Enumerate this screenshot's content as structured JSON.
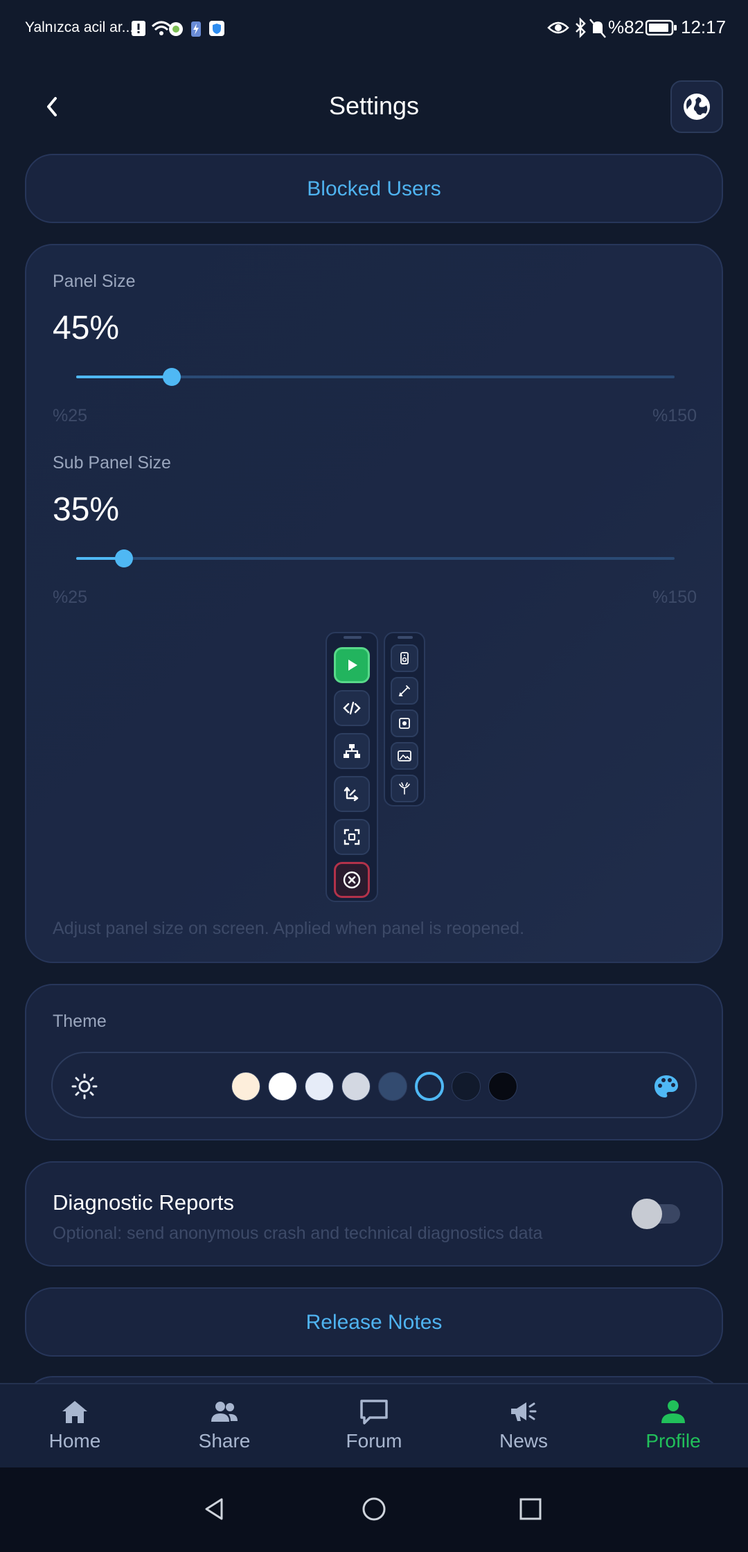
{
  "status_bar": {
    "left_text": "Yalnızca acil ar...",
    "battery": "%82",
    "time": "12:17"
  },
  "header": {
    "title": "Settings",
    "back_icon": "chevron-left-icon",
    "globe_icon": "globe-icon"
  },
  "blocked_users": {
    "label": "Blocked Users"
  },
  "panel_size": {
    "label": "Panel Size",
    "value_text": "45%",
    "value_percent": 45,
    "min_label": "%25",
    "max_label": "%150",
    "min": 25,
    "max": 150
  },
  "sub_panel_size": {
    "label": "Sub Panel Size",
    "value_text": "35%",
    "value_percent": 35,
    "min_label": "%25",
    "max_label": "%150",
    "min": 25,
    "max": 150
  },
  "panel_hint": "Adjust panel size on screen. Applied when panel is reopened.",
  "panel_preview": {
    "main_icons": [
      "play-icon",
      "code-icon",
      "sitemap-icon",
      "arrows-icon",
      "capture-icon",
      "close-icon"
    ],
    "sub_icons": [
      "speaker-icon",
      "brush-icon",
      "record-icon",
      "image-icon",
      "lamp-icon"
    ]
  },
  "theme": {
    "label": "Theme",
    "left_icon": "sun-icon",
    "right_icon": "palette-icon",
    "swatches": [
      "#fdeedb",
      "#ffffff",
      "#e6ecf8",
      "#d3d8e2",
      "#334b70",
      "#18243e",
      "#111a2c",
      "#070a12"
    ],
    "selected_index": 5,
    "accent": "#4fb8f4"
  },
  "diagnostics": {
    "title": "Diagnostic Reports",
    "subtitle": "Optional: send anonymous crash and technical diagnostics data",
    "enabled": false
  },
  "release_notes": {
    "label": "Release Notes"
  },
  "nav": {
    "items": [
      {
        "label": "Home",
        "icon": "home-icon",
        "active": false
      },
      {
        "label": "Share",
        "icon": "users-icon",
        "active": false
      },
      {
        "label": "Forum",
        "icon": "chat-icon",
        "active": false
      },
      {
        "label": "News",
        "icon": "megaphone-icon",
        "active": false
      },
      {
        "label": "Profile",
        "icon": "person-icon",
        "active": true
      }
    ],
    "active_color": "#21c05a",
    "inactive_color": "#a8b6cf"
  },
  "system_nav": [
    "back-triangle-icon",
    "home-circle-icon",
    "recents-square-icon"
  ]
}
